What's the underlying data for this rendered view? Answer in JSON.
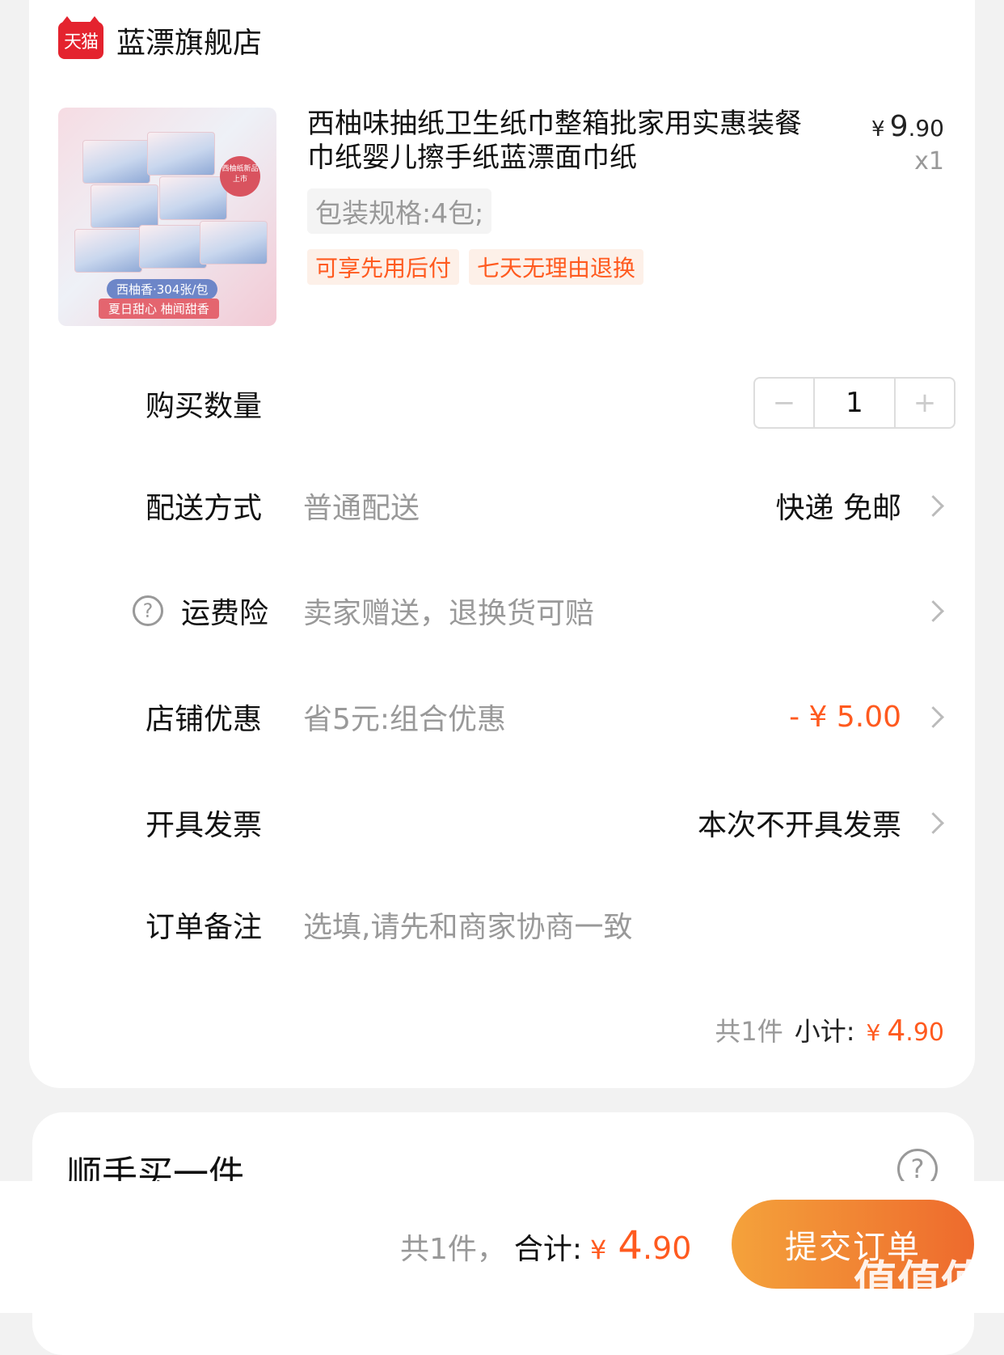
{
  "store": {
    "logo_text": "天猫",
    "name": "蓝漂旗舰店"
  },
  "product": {
    "title": "西柚味抽纸卫生纸巾整箱批家用实惠装餐巾纸婴儿擦手纸蓝漂面巾纸",
    "price_currency": "¥",
    "price_int": "9",
    "price_dec": ".90",
    "quantity_label": "x1",
    "spec": "包装规格:4包;",
    "tags": [
      "可享先用后付",
      "七天无理由退换"
    ],
    "thumb_stamp": "西柚纸新品上市",
    "thumb_caption1": "西柚香·304张/包",
    "thumb_caption2": "夏日甜心  柚闻甜香"
  },
  "quantity": {
    "label": "购买数量",
    "minus": "−",
    "value": "1",
    "plus": "+"
  },
  "delivery": {
    "label": "配送方式",
    "sub": "普通配送",
    "value": "快递 免邮"
  },
  "insurance": {
    "help": "?",
    "label": "运费险",
    "sub": "卖家赠送，退换货可赔"
  },
  "discount": {
    "label": "店铺优惠",
    "sub": "省5元:组合优惠",
    "value": "- ¥ 5.00",
    "value_color": "#ff5a1f"
  },
  "invoice": {
    "label": "开具发票",
    "value": "本次不开具发票"
  },
  "note": {
    "label": "订单备注",
    "placeholder": "选填,请先和商家协商一致"
  },
  "subtotal": {
    "count": "共1件",
    "label": "小计:",
    "currency": "¥",
    "int": "4",
    "dec": ".90"
  },
  "addon": {
    "title": "顺手买一件",
    "help": "?"
  },
  "footer": {
    "count": "共1件，",
    "label": "合计:",
    "currency": "¥",
    "int": "4",
    "dec": ".90",
    "submit": "提交订单",
    "accent": "#ff5a1f",
    "watermark": "值值值",
    "watermark_url": "zhizhizhi.com"
  }
}
